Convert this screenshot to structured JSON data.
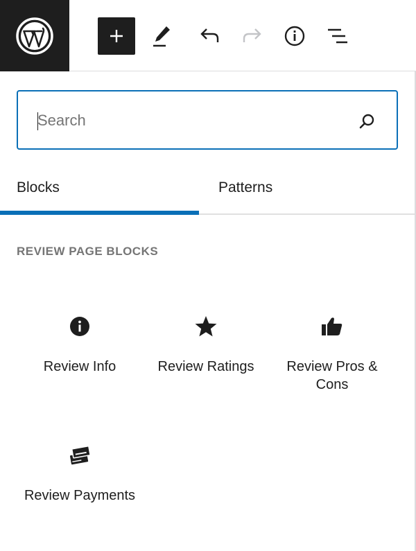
{
  "toolbar": {
    "logo_icon": "wordpress-logo-icon",
    "add_icon": "plus-icon",
    "tools_icon": "pencil-icon",
    "undo_icon": "undo-icon",
    "redo_icon": "redo-icon",
    "details_icon": "info-icon",
    "list_view_icon": "list-view-icon",
    "accent": "#1e1e1e"
  },
  "search": {
    "placeholder": "Search",
    "value": "",
    "icon": "search-icon",
    "border_color": "#0a6fb7"
  },
  "tabs": [
    {
      "label": "Blocks",
      "selected": true
    },
    {
      "label": "Patterns",
      "selected": false
    }
  ],
  "tab_accent": "#0a6fb7",
  "category": {
    "title": "REVIEW PAGE BLOCKS",
    "blocks": [
      {
        "label": "Review Info",
        "icon": "info-icon"
      },
      {
        "label": "Review Ratings",
        "icon": "star-icon"
      },
      {
        "label": "Review Pros & Cons",
        "icon": "thumbs-up-icon"
      },
      {
        "label": "Review Payments",
        "icon": "payments-icon"
      }
    ]
  }
}
